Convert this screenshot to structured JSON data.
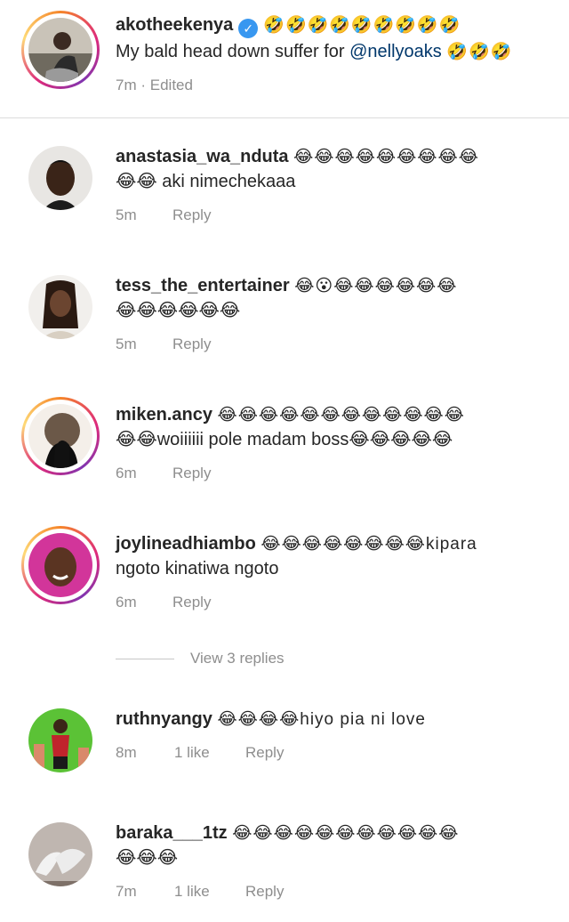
{
  "caption": {
    "username": "akotheekenya",
    "emoji": "🤣🤣🤣🤣🤣🤣🤣🤣🤣",
    "text": "My bald head down suffer for ",
    "mention": "@nellyoaks",
    "trail_emoji": "🤣🤣🤣",
    "time": "7m",
    "edited": "· Edited"
  },
  "comments": [
    {
      "username": "anastasia_wa_nduta",
      "line1_emoji": "😂😂😂😂😂😂😂😂😂",
      "line2": "😂😂 aki nimechekaaa",
      "time": "5m",
      "reply": "Reply"
    },
    {
      "username": "tess_the_entertainer",
      "line1_emoji": "😂😮😂😂😂😂😂😂",
      "line2": "😂😂😂😂😂😂",
      "time": "5m",
      "reply": "Reply"
    },
    {
      "username": "miken.ancy",
      "line1_emoji": "😂😂😂😂😂😂😂😂😂😂😂😂",
      "line2": "😂😂woiiiiii pole madam boss😂😂😂😂😂",
      "time": "6m",
      "reply": "Reply"
    },
    {
      "username": "joylineadhiambo",
      "line1_emoji": "😂😂😂😂😂😂😂😂kipara",
      "line2": "ngoto kinatiwa ngoto",
      "time": "6m",
      "reply": "Reply"
    },
    {
      "username": "ruthnyangy",
      "line1_emoji": "😂😂😂😂hiyo pia ni love",
      "time": "8m",
      "likes": "1 like",
      "reply": "Reply"
    },
    {
      "username": "baraka___1tz",
      "line1_emoji": "😂😂😂😂😂😂😂😂😂😂😂",
      "line2": "😂😂😂",
      "time": "7m",
      "likes": "1 like",
      "reply": "Reply"
    }
  ],
  "view_replies": "View 3 replies"
}
